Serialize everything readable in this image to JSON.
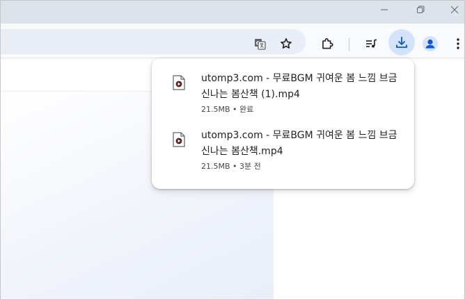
{
  "colors": {
    "titlebar": "#dde3ea",
    "toolbar": "#f8fafd",
    "omnibox": "#e9eef6",
    "accent": "#0b57d0",
    "download_active_bg": "#d3e3fd"
  },
  "toolbar": {
    "icons": [
      "translate-icon",
      "bookmark-star-icon",
      "extensions-icon",
      "reading-list-icon",
      "download-icon",
      "profile-icon",
      "menu-icon"
    ]
  },
  "downloads": {
    "items": [
      {
        "filename": "utomp3.com - 무료BGM 귀여운 봄 느낌 브금  신나는 봄산책 (1).mp4",
        "size": "21.5MB",
        "separator": "•",
        "status": "완료"
      },
      {
        "filename": "utomp3.com - 무료BGM 귀여운 봄 느낌 브금  신나는 봄산책.mp4",
        "size": "21.5MB",
        "separator": "•",
        "status": "3분 전"
      }
    ]
  }
}
